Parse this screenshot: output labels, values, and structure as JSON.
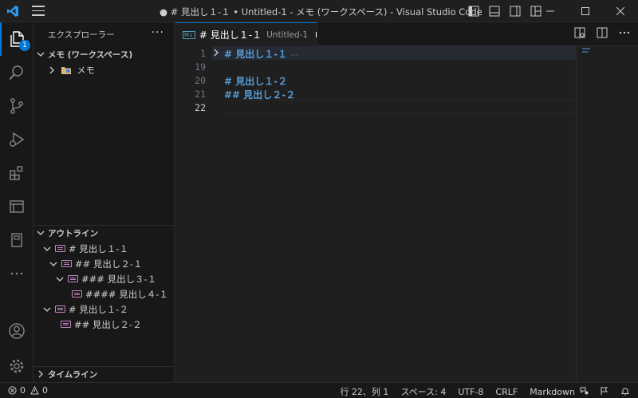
{
  "window": {
    "title": "● # 見出し１-１ • Untitled-1 - メモ (ワークスペース) - Visual Studio Code"
  },
  "activity_bar": {
    "explorer_badge": "1",
    "icons": [
      "files-icon",
      "search-icon",
      "source-control-icon",
      "run-debug-icon",
      "extensions-icon",
      "remote-explorer-icon",
      "notebook-icon",
      "more-icon",
      "account-icon",
      "gear-icon"
    ]
  },
  "sidebar": {
    "header": "エクスプローラー",
    "more": "···",
    "workspace": {
      "label": "メモ (ワークスペース)",
      "folder": "メモ"
    },
    "outline": {
      "label": "アウトライン",
      "items": [
        {
          "label": "# 見出し１-１",
          "level": 0
        },
        {
          "label": "## 見出し２-１",
          "level": 1
        },
        {
          "label": "### 見出し３-１",
          "level": 2
        },
        {
          "label": "#### 見出し４-１",
          "level": 3
        },
        {
          "label": "# 見出し１-２",
          "level": 0
        },
        {
          "label": "## 見出し２-２",
          "level": 1
        }
      ]
    },
    "timeline": {
      "label": "タイムライン"
    }
  },
  "tab": {
    "icon_text": "M↓",
    "name": "# 見出し１-１",
    "description": "Untitled-1"
  },
  "editor": {
    "lines": [
      {
        "number": "1",
        "text": "# 見出し１-１",
        "folded": true,
        "ellipsis": "⋯"
      },
      {
        "number": "19",
        "text": ""
      },
      {
        "number": "20",
        "text": "# 見出し１-２"
      },
      {
        "number": "21",
        "text": "## 見出し２-２"
      },
      {
        "number": "22",
        "text": "",
        "current": true
      }
    ]
  },
  "statusbar": {
    "errors": "0",
    "warnings": "0",
    "position": "行 22、列 1",
    "spaces": "スペース: 4",
    "encoding": "UTF-8",
    "eol": "CRLF",
    "language": "Markdown"
  },
  "colors": {
    "accent": "#0078d4",
    "heading": "#569cd6",
    "background": "#1f1f1f",
    "sidebar": "#181818"
  }
}
